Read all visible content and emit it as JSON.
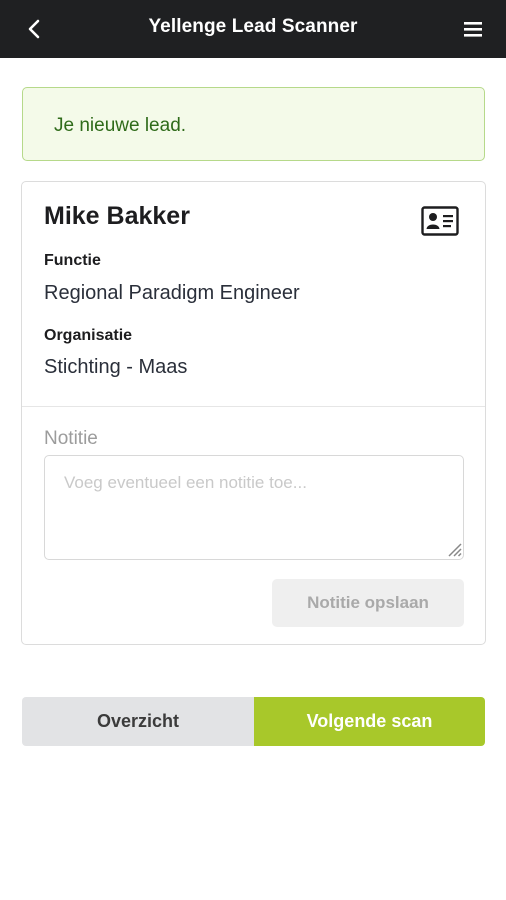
{
  "header": {
    "title": "Yellenge Lead Scanner",
    "back_icon": "chevron-left-icon",
    "menu_icon": "hamburger-menu-icon"
  },
  "alert": {
    "message": "Je nieuwe lead."
  },
  "lead": {
    "name": "Mike Bakker",
    "icon": "contact-card-icon",
    "function_label": "Functie",
    "function_value": "Regional Paradigm Engineer",
    "organisation_label": "Organisatie",
    "organisation_value": "Stichting - Maas"
  },
  "note": {
    "label": "Notitie",
    "placeholder": "Voeg eventueel een notitie toe...",
    "value": "",
    "save_label": "Notitie opslaan"
  },
  "actions": {
    "overview_label": "Overzicht",
    "next_scan_label": "Volgende scan"
  },
  "colors": {
    "header_bg": "#1f2022",
    "accent_green": "#a8c82a",
    "alert_bg": "#f4fae9",
    "alert_border": "#b6d98a",
    "alert_text": "#2f6b1a"
  }
}
